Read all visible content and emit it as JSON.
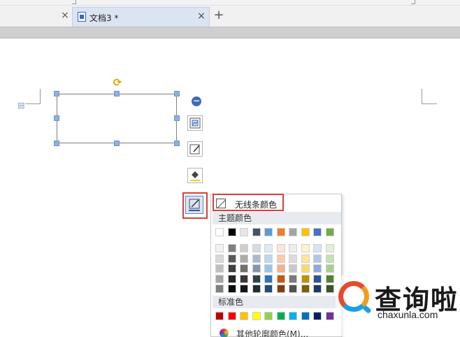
{
  "tabs": {
    "active": {
      "title": "文档3 *",
      "close": "×"
    },
    "prev_close": "×",
    "add": "+"
  },
  "shape_toolbar": {
    "collapse": "−",
    "buttons": [
      {
        "icon": "layout-options-icon"
      },
      {
        "icon": "shape-style-icon"
      },
      {
        "icon": "fill-bucket-icon",
        "color": "#f2d21a"
      },
      {
        "icon": "outline-pen-icon",
        "color": "#2f54c0"
      }
    ]
  },
  "outline_menu": {
    "no_line_label": "无线条颜色",
    "theme_header": "主题颜色",
    "theme_colors": [
      "#ffffff",
      "#000000",
      "#e7e6e6",
      "#44546a",
      "#5b9bd5",
      "#ed7d31",
      "#a5a5a5",
      "#ffc000",
      "#4472c4",
      "#70ad47"
    ],
    "theme_shades": [
      [
        "#f2f2f2",
        "#7f7f7f",
        "#d0cece",
        "#d6dce4",
        "#deebf6",
        "#fbe5d5",
        "#ededed",
        "#fff2cc",
        "#dae3f3",
        "#e2efd9"
      ],
      [
        "#d8d8d8",
        "#595959",
        "#aeabab",
        "#adb9ca",
        "#bdd7ee",
        "#f8cbad",
        "#dbdbdb",
        "#fee599",
        "#b4c6e7",
        "#c5e0b3"
      ],
      [
        "#bfbfbf",
        "#3f3f3f",
        "#757070",
        "#8496b0",
        "#9dc3e6",
        "#f4b183",
        "#c9c9c9",
        "#ffd965",
        "#8eaadb",
        "#a8d08d"
      ],
      [
        "#a5a5a5",
        "#262626",
        "#3a3838",
        "#323f4f",
        "#2e75b5",
        "#c55a11",
        "#7b7b7b",
        "#bf9000",
        "#2f5496",
        "#538135"
      ],
      [
        "#7f7f7f",
        "#0c0c0c",
        "#171616",
        "#222a35",
        "#1e4e79",
        "#833c0b",
        "#525252",
        "#7f6000",
        "#1f3864",
        "#375623"
      ]
    ],
    "standard_header": "标准色",
    "standard_colors": [
      "#c00000",
      "#ff0000",
      "#ffc000",
      "#ffff00",
      "#92d050",
      "#00b050",
      "#00b0f0",
      "#0070c0",
      "#002060",
      "#7030a0"
    ],
    "more_label": "其他轮廓颜色(M)..."
  },
  "watermark": {
    "brand": "查询啦",
    "domain": "chaxunla.com"
  }
}
